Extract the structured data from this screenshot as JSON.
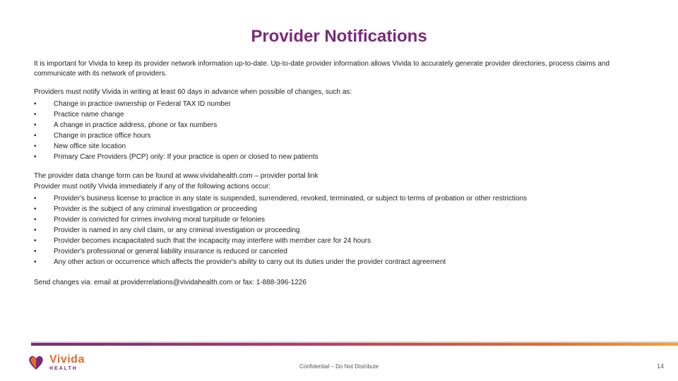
{
  "title": "Provider Notifications",
  "intro": "It is important for Vivida to keep its provider network information up-to-date. Up-to-date provider information allows Vivida to accurately generate provider directories, process claims and communicate with its network of providers.",
  "notify_lead": "Providers must notify Vivida in writing at least 60 days in advance when possible of changes, such as:",
  "notify_bullets": [
    "Change in practice ownership or Federal TAX ID number",
    "Practice name change",
    "A change in practice address, phone or fax numbers",
    "Change in practice office hours",
    "New office site location",
    "Primary Care Providers (PCP) only: If your practice is open or closed to new patients"
  ],
  "form_line": "The provider data change form can be found at www.vividahealth.com – provider portal link",
  "immediate_lead": "Provider must notify Vivida immediately if any of the following actions occur:",
  "immediate_bullets": [
    "Provider's business license to practice in any state is suspended, surrendered, revoked, terminated, or subject to terms of probation or other restrictions",
    "Provider is the subject of any criminal investigation or proceeding",
    "Provider is convicted for crimes involving moral turpitude or felonies",
    "Provider is named in any civil claim, or any criminal investigation or proceeding",
    "Provider becomes incapacitated such that the incapacity may interfere with member care for 24 hours",
    "Provider's professional or general liability insurance is reduced or canceled",
    "Any other action or occurrence which affects the provider's ability to carry out its duties under the provider contract agreement"
  ],
  "send_line": "Send changes via: email at providerrelations@vividahealth.com or fax: 1-888-396-1226",
  "logo": {
    "name": "Vivida",
    "sub": "HEALTH"
  },
  "confidential": "Confidential – Do Not Distribute",
  "page_number": "14",
  "colors": {
    "accent_purple": "#7a2a7a",
    "accent_orange": "#e86a2a"
  }
}
